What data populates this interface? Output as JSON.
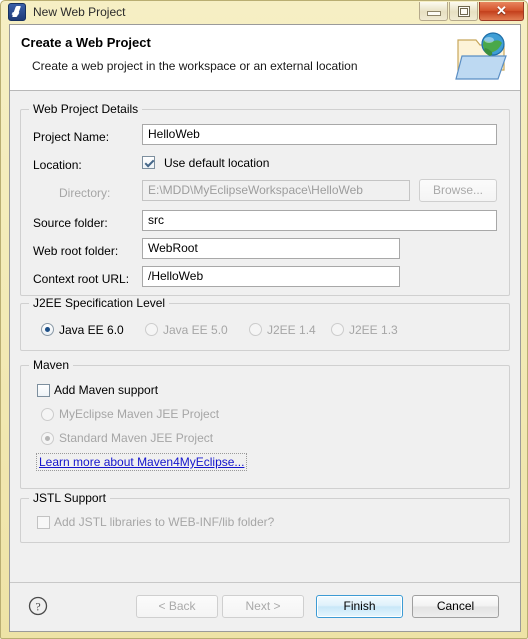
{
  "window": {
    "title": "New Web Project",
    "app_icon": "myeclipse-icon",
    "controls": {
      "minimize": "minimize-icon",
      "maximize": "maximize-icon",
      "close": "close-icon",
      "close_glyph": "✕"
    }
  },
  "banner": {
    "title": "Create a Web Project",
    "description": "Create a web project in the workspace or an external location",
    "icon": "web-project-folder-globe-icon"
  },
  "web_project_details": {
    "group_label": "Web Project Details",
    "project_name": {
      "label": "Project Name:",
      "value": "HelloWeb"
    },
    "location": {
      "label": "Location:",
      "use_default_label": "Use default location",
      "use_default_checked": true
    },
    "directory": {
      "label": "Directory:",
      "value": "E:\\MDD\\MyEclipseWorkspace\\HelloWeb",
      "disabled": true,
      "browse_label": "Browse..."
    },
    "source_folder": {
      "label": "Source folder:",
      "value": "src"
    },
    "web_root_folder": {
      "label": "Web root folder:",
      "value": "WebRoot"
    },
    "context_root_url": {
      "label": "Context root URL:",
      "value": "/HelloWeb"
    }
  },
  "j2ee_spec": {
    "group_label": "J2EE Specification Level",
    "options": [
      {
        "label": "Java EE 6.0",
        "selected": true,
        "disabled": false
      },
      {
        "label": "Java EE 5.0",
        "selected": false,
        "disabled": true
      },
      {
        "label": "J2EE 1.4",
        "selected": false,
        "disabled": true
      },
      {
        "label": "J2EE 1.3",
        "selected": false,
        "disabled": true
      }
    ]
  },
  "maven": {
    "group_label": "Maven",
    "add_support": {
      "label": "Add Maven support",
      "checked": false
    },
    "options": [
      {
        "label": "MyEclipse Maven JEE Project",
        "selected": false,
        "disabled": true
      },
      {
        "label": "Standard Maven JEE Project",
        "selected": true,
        "disabled": true
      }
    ],
    "link": "Learn more about Maven4MyEclipse..."
  },
  "jstl": {
    "group_label": "JSTL Support",
    "checkbox": {
      "label": "Add JSTL libraries to WEB-INF/lib folder?",
      "checked": false,
      "disabled": true
    }
  },
  "buttons": {
    "help": "help-icon",
    "back": {
      "label": "< Back",
      "disabled": true
    },
    "next": {
      "label": "Next >",
      "disabled": true
    },
    "finish": {
      "label": "Finish",
      "default": true
    },
    "cancel": {
      "label": "Cancel"
    }
  },
  "colors": {
    "frame": "#f3ebb9",
    "dialog_bg": "#f0f0f0",
    "banner_bg": "#ffffff",
    "link": "#1414cc",
    "default_button_border": "#3c9bd4",
    "close_button": "#d4532c",
    "radio_dot": "#1d4f87"
  }
}
